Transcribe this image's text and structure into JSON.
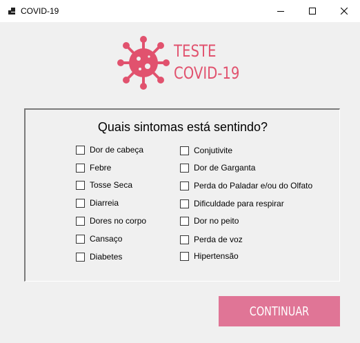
{
  "window": {
    "title": "COVID-19",
    "icons": {
      "app": "app-icon",
      "minimize": "minimize-icon",
      "maximize": "maximize-icon",
      "close": "close-icon"
    }
  },
  "logo": {
    "icon": "virus-icon",
    "line1": "TESTE",
    "line2": "COVID-19",
    "color": "#e1526e"
  },
  "symptoms": {
    "question": "Quais sintomas está sentindo?",
    "left": [
      {
        "label": "Dor de cabeça",
        "checked": false
      },
      {
        "label": "Febre",
        "checked": false
      },
      {
        "label": "Tosse Seca",
        "checked": false
      },
      {
        "label": "Diarreia",
        "checked": false
      },
      {
        "label": "Dores no corpo",
        "checked": false
      },
      {
        "label": "Cansaço",
        "checked": false
      },
      {
        "label": "Diabetes",
        "checked": false
      }
    ],
    "right": [
      {
        "label": "Conjutivite",
        "checked": false
      },
      {
        "label": "Dor de Garganta",
        "checked": false
      },
      {
        "label": "Perda do Paladar e/ou do Olfato",
        "checked": false
      },
      {
        "label": "Dificuldade  para respirar",
        "checked": false
      },
      {
        "label": "Dor no peito",
        "checked": false
      },
      {
        "label": "Perda de voz",
        "checked": false
      },
      {
        "label": "Hipertensão",
        "checked": false
      }
    ]
  },
  "continue_button": {
    "label": "CONTINUAR",
    "color": "#e07596"
  }
}
